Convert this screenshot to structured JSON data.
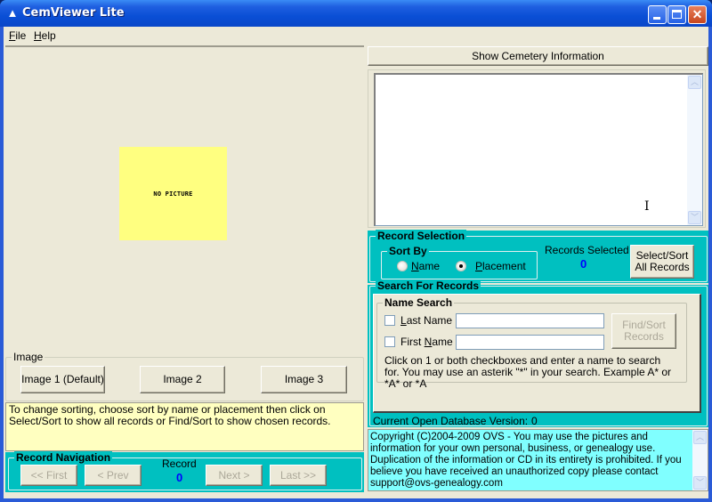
{
  "window": {
    "title": "CemViewer Lite",
    "icon": "app-bell-icon",
    "controls": {
      "minimize": "_",
      "maximize": "□",
      "close": "✕"
    }
  },
  "menu": {
    "items": [
      {
        "label": "File",
        "accel": "F",
        "rest": "ile"
      },
      {
        "label": "Help",
        "accel": "H",
        "rest": "elp"
      }
    ]
  },
  "picture": {
    "placeholder": "NO PICTURE",
    "placeholder_color": "#ffff80"
  },
  "image_group": {
    "title": "Image",
    "buttons": [
      "Image 1 (Default)",
      "Image 2",
      "Image 3"
    ]
  },
  "hint_text": "To change sorting, choose sort by name or placement then click on Select/Sort to show all records or Find/Sort to show chosen records.",
  "record_navigation": {
    "title": "Record Navigation",
    "first": "<< First",
    "prev": "< Prev",
    "next": "Next >",
    "last": "Last >>",
    "record_label": "Record",
    "record_value": "0"
  },
  "cemetery": {
    "button": "Show Cemetery Information",
    "text": ""
  },
  "record_selection": {
    "title": "Record Selection",
    "sort_by": {
      "title": "Sort By",
      "options": [
        {
          "label": "Name",
          "accel": "N",
          "rest": "ame",
          "checked": false
        },
        {
          "label": "Placement",
          "accel": "P",
          "rest": "lacement",
          "checked": true
        }
      ]
    },
    "records_selected_label": "Records Selected",
    "records_selected_value": "0",
    "select_sort_button_line1": "Select/Sort",
    "select_sort_button_line2": "All Records"
  },
  "search": {
    "title": "Search For Records",
    "name_search_title": "Name Search",
    "last_name": {
      "pre": "",
      "accel": "L",
      "rest": "ast Name",
      "value": "",
      "checked": false
    },
    "first_name": {
      "pre": "First ",
      "accel": "N",
      "rest": "ame",
      "value": "",
      "checked": false
    },
    "find_sort_line1": "Find/Sort",
    "find_sort_line2": "Records",
    "instructions": "Click on 1 or both checkboxes and enter a name to search for. You may use an asterik \"*\" in your search. Example A* or *A* or *A"
  },
  "database": {
    "label": "Current Open Database Version:",
    "value": "0"
  },
  "copyright": "Copyright (C)2004-2009 OVS - You may use the pictures and information for your own personal, business, or genealogy use. Duplication of the information or CD in its entirety is prohibited. If you believe you have received an unauthorized copy please contact support@ovs-genealogy.com",
  "colors": {
    "teal_panel": "#00c0c0",
    "hint_bg": "#ffffc0",
    "copyright_bg": "#80ffff",
    "value_blue": "#0000ff"
  }
}
